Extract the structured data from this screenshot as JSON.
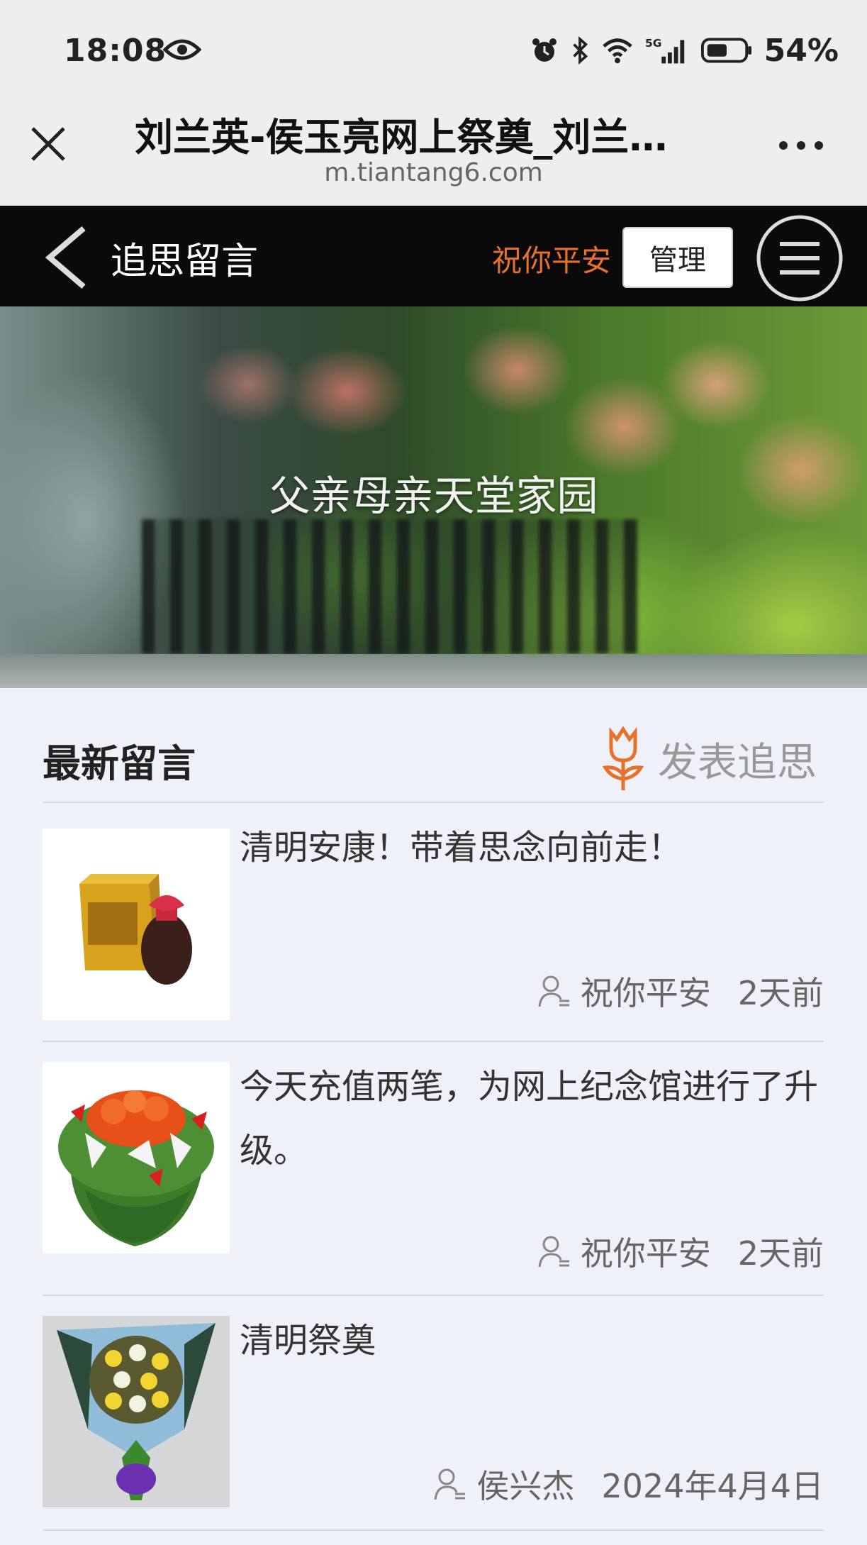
{
  "status_bar": {
    "time": "18:08",
    "network": "5G",
    "battery": "54%",
    "icons": [
      "eye-icon",
      "alarm-icon",
      "bluetooth-icon",
      "wifi-icon",
      "signal-icon",
      "battery-icon"
    ]
  },
  "browser": {
    "title": "刘兰英-侯玉亮网上祭奠_刘兰…",
    "url": "m.tiantang6.com"
  },
  "header": {
    "title": "追思留言",
    "username": "祝你平安",
    "manage_label": "管理"
  },
  "banner": {
    "title": "父亲母亲天堂家园"
  },
  "section": {
    "title": "最新留言",
    "post_label": "发表追思"
  },
  "colors": {
    "accent": "#e8702a",
    "header_bg": "#0a0a0a",
    "page_bg": "#eef2f8"
  },
  "messages": [
    {
      "text": "清明安康！带着思念向前走！",
      "author": "祝你平安",
      "date": "2天前",
      "image": "liquor-gift-box"
    },
    {
      "text": "今天充值两笔，为网上纪念馆进行了升级。",
      "author": "祝你平安",
      "date": "2天前",
      "image": "flower-bouquet-red-lilies"
    },
    {
      "text": "清明祭奠",
      "author": "侯兴杰",
      "date": "2024年4月4日",
      "image": "chrysanthemum-bouquet"
    }
  ]
}
